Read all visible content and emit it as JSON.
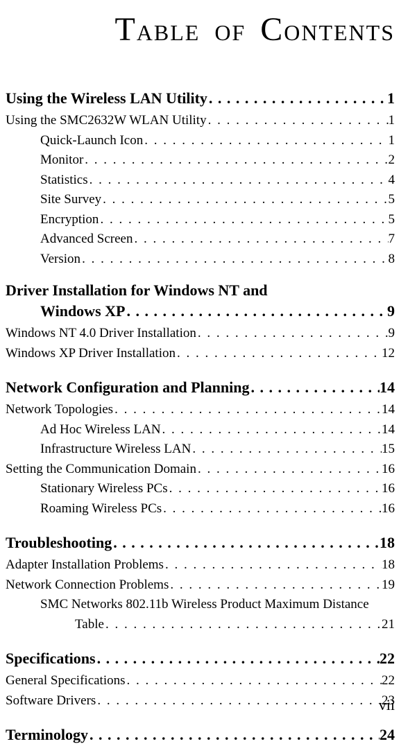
{
  "title_line": "TABLE OF CONTENTS",
  "folio": "vii",
  "sections": {
    "s1": {
      "label": "Using the Wireless LAN Utility",
      "page": "1"
    },
    "s1a": {
      "label": "Using the SMC2632W WLAN Utility",
      "page": "1"
    },
    "s1a1": {
      "label": "Quick-Launch Icon",
      "page": "1"
    },
    "s1a2": {
      "label": "Monitor",
      "page": "2"
    },
    "s1a3": {
      "label": "Statistics",
      "page": "4"
    },
    "s1a4": {
      "label": "Site Survey",
      "page": "5"
    },
    "s1a5": {
      "label": "Encryption",
      "page": "5"
    },
    "s1a6": {
      "label": "Advanced Screen",
      "page": "7"
    },
    "s1a7": {
      "label": "Version",
      "page": "8"
    },
    "s2_line1": "Driver Installation for Windows NT and",
    "s2_line2": {
      "label": "Windows XP",
      "page": "9"
    },
    "s2a": {
      "label": "Windows NT 4.0 Driver Installation",
      "page": "9"
    },
    "s2b": {
      "label": "Windows XP Driver Installation",
      "page": "12"
    },
    "s3": {
      "label": "Network Configuration and Planning",
      "page": "14"
    },
    "s3a": {
      "label": "Network Topologies",
      "page": "14"
    },
    "s3a1": {
      "label": "Ad Hoc Wireless LAN",
      "page": "14"
    },
    "s3a2": {
      "label": "Infrastructure Wireless LAN",
      "page": "15"
    },
    "s3b": {
      "label": "Setting the Communication Domain",
      "page": "16"
    },
    "s3b1": {
      "label": "Stationary Wireless PCs",
      "page": "16"
    },
    "s3b2": {
      "label": "Roaming Wireless PCs",
      "page": "16"
    },
    "s4": {
      "label": "Troubleshooting",
      "page": "18"
    },
    "s4a": {
      "label": "Adapter Installation Problems",
      "page": "18"
    },
    "s4b": {
      "label": "Network Connection Problems",
      "page": "19"
    },
    "s4c_line": "SMC Networks 802.11b Wireless Product Maximum Distance",
    "s4c_cont": {
      "label": "Table",
      "page": "21"
    },
    "s5": {
      "label": "Specifications",
      "page": "22"
    },
    "s5a": {
      "label": "General Specifications",
      "page": "22"
    },
    "s5b": {
      "label": "Software Drivers",
      "page": "23"
    },
    "s6": {
      "label": "Terminology",
      "page": "24"
    }
  }
}
